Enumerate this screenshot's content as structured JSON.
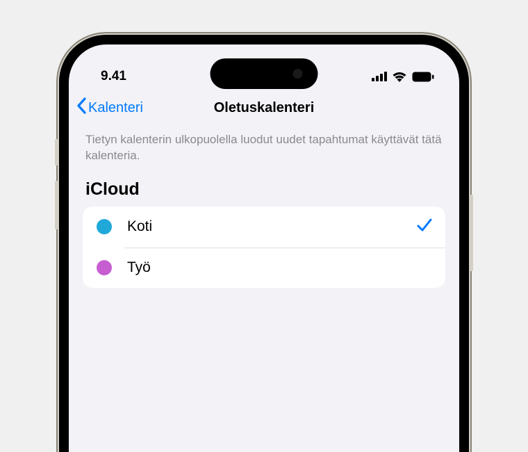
{
  "status": {
    "time": "9.41"
  },
  "nav": {
    "back_label": "Kalenteri",
    "title": "Oletuskalenteri"
  },
  "description": "Tietyn kalenterin ulkopuolella luodut uudet tapahtumat käyttävät tätä kalenteria.",
  "section": {
    "header": "iCloud",
    "items": [
      {
        "label": "Koti",
        "color": "#1fa8d8",
        "selected": true
      },
      {
        "label": "Työ",
        "color": "#c65ed1",
        "selected": false
      }
    ]
  }
}
